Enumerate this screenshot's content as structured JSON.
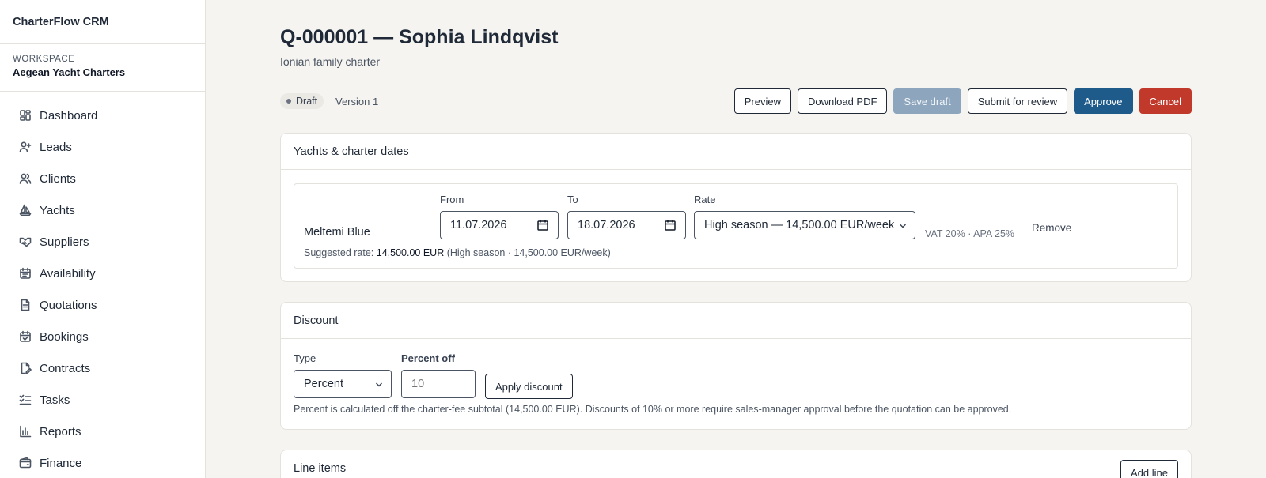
{
  "app": {
    "name": "CharterFlow CRM"
  },
  "workspace": {
    "label": "WORKSPACE",
    "name": "Aegean Yacht Charters"
  },
  "sidebar": {
    "items": [
      {
        "label": "Dashboard",
        "icon": "dashboard-icon"
      },
      {
        "label": "Leads",
        "icon": "user-plus-icon"
      },
      {
        "label": "Clients",
        "icon": "users-icon"
      },
      {
        "label": "Yachts",
        "icon": "sailboat-icon"
      },
      {
        "label": "Suppliers",
        "icon": "handshake-icon"
      },
      {
        "label": "Availability",
        "icon": "calendar-icon"
      },
      {
        "label": "Quotations",
        "icon": "document-icon"
      },
      {
        "label": "Bookings",
        "icon": "calendar-check-icon"
      },
      {
        "label": "Contracts",
        "icon": "contract-icon"
      },
      {
        "label": "Tasks",
        "icon": "checklist-icon"
      },
      {
        "label": "Reports",
        "icon": "bar-chart-icon"
      },
      {
        "label": "Finance",
        "icon": "wallet-icon"
      }
    ]
  },
  "quote": {
    "title": "Q-000001 — Sophia Lindqvist",
    "subtitle": "Ionian family charter",
    "status": "Draft",
    "version": "Version 1"
  },
  "actions": {
    "preview": "Preview",
    "download_pdf": "Download PDF",
    "save_draft": "Save draft",
    "submit_review": "Submit for review",
    "approve": "Approve",
    "cancel": "Cancel"
  },
  "yachts_section": {
    "title": "Yachts & charter dates",
    "yacht_name": "Meltemi Blue",
    "from_label": "From",
    "from_value": "11.07.2026",
    "to_label": "To",
    "to_value": "18.07.2026",
    "rate_label": "Rate",
    "rate_value": "High season — 14,500.00 EUR/week",
    "meta": "VAT 20% · APA 25%",
    "remove": "Remove",
    "suggested_prefix": "Suggested rate:",
    "suggested_amount": "14,500.00 EUR",
    "suggested_detail": "(High season · 14,500.00 EUR/week)"
  },
  "discount_section": {
    "title": "Discount",
    "type_label": "Type",
    "type_value": "Percent",
    "percent_label": "Percent off",
    "percent_placeholder": "10",
    "apply": "Apply discount",
    "note": "Percent is calculated off the charter-fee subtotal (14,500.00 EUR). Discounts of 10% or more require sales-manager approval before the quotation can be approved."
  },
  "lines_section": {
    "title": "Line items",
    "add_line": "Add line"
  }
}
